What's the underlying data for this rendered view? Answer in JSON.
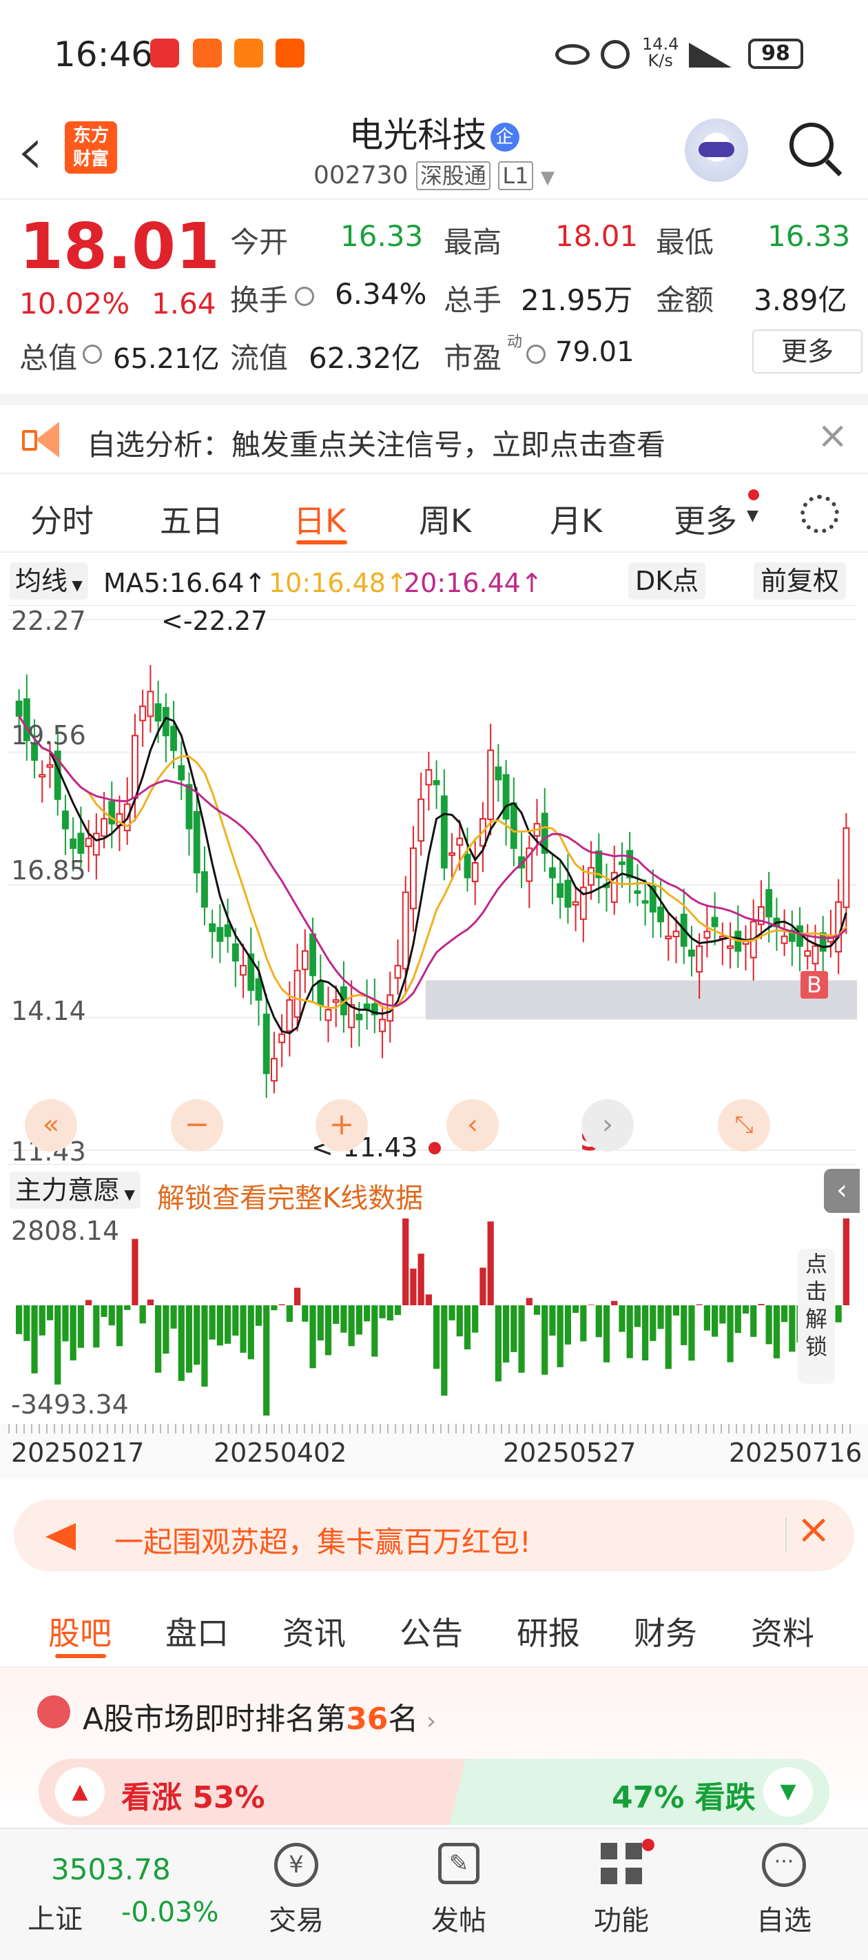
{
  "status_bar": {
    "time": "16:46",
    "net_speed_top": "14.4",
    "net_speed_bottom": "K/s",
    "battery": "98"
  },
  "header": {
    "back_label": "‹",
    "logo_line1": "东方",
    "logo_line2": "财富",
    "stock_name": "电光科技",
    "badge": "企",
    "stock_code": "002730",
    "market_tag": "深股通",
    "level_tag": "L1"
  },
  "quote": {
    "price": "18.01",
    "change_pct": "10.02%",
    "change_amt": "1.64",
    "rows": [
      [
        {
          "label": "今开",
          "value": "16.33",
          "color": "green"
        },
        {
          "label": "最高",
          "value": "18.01",
          "color": "red"
        },
        {
          "label": "最低",
          "value": "16.33",
          "color": "green"
        }
      ],
      [
        {
          "label": "换手",
          "value": "6.34%",
          "color": "dark"
        },
        {
          "label": "总手",
          "value": "21.95万",
          "color": "dark"
        },
        {
          "label": "金额",
          "value": "3.89亿",
          "color": "dark"
        }
      ]
    ],
    "total_mv_label": "总值",
    "total_mv": "65.21亿",
    "float_mv_label": "流值",
    "float_mv": "62.32亿",
    "pe_label": "市盈",
    "pe_sup": "动",
    "pe": "79.01",
    "more_button": "更多"
  },
  "banner": {
    "text": "自选分析：触发重点关注信号，立即点击查看"
  },
  "kline_tabs": [
    "分时",
    "五日",
    "日K",
    "周K",
    "月K",
    "更多"
  ],
  "kline_active": 2,
  "ma_bar": {
    "selector": "均线",
    "ma5": "MA5:16.64↑",
    "ma10": "10:16.48↑",
    "ma20": "20:16.44↑",
    "dk": "DK点",
    "adjust": "前复权"
  },
  "chart_data": {
    "type": "candlestick",
    "y_ticks": [
      "22.27",
      "19.56",
      "16.85",
      "14.14",
      "11.43"
    ],
    "ylim": [
      11.43,
      22.27
    ],
    "high_annotation": "<-22.27",
    "low_annotation": "<-11.43",
    "marker_b": "B",
    "marker_s": "S",
    "closes": [
      20.3,
      19.8,
      19.4,
      19.1,
      19.3,
      18.6,
      18.0,
      17.6,
      17.5,
      17.8,
      17.9,
      18.2,
      18.1,
      18.3,
      18.5,
      19.9,
      20.5,
      20.8,
      20.2,
      19.9,
      19.6,
      19.0,
      18.0,
      17.1,
      16.4,
      15.9,
      15.7,
      15.8,
      15.3,
      15.2,
      14.7,
      14.5,
      13.0,
      13.3,
      13.8,
      14.5,
      15.1,
      15.5,
      15.0,
      14.4,
      14.3,
      14.5,
      14.2,
      14.4,
      14.1,
      14.3,
      14.2,
      14.1,
      14.6,
      15.2,
      16.7,
      17.6,
      18.6,
      19.2,
      18.9,
      17.2,
      17.5,
      17.8,
      17.0,
      17.3,
      18.2,
      19.6,
      19.0,
      18.2,
      17.6,
      17.2,
      17.6,
      18.1,
      17.5,
      17.0,
      16.6,
      16.4,
      16.5,
      16.8,
      17.2,
      17.0,
      16.8,
      17.1,
      17.3,
      17.0,
      16.7,
      16.5,
      16.3,
      16.1,
      15.8,
      15.9,
      15.6,
      15.4,
      15.6,
      15.9,
      16.0,
      15.8,
      15.6,
      15.5,
      15.7,
      16.1,
      16.4,
      16.2,
      16.0,
      15.8,
      15.7,
      15.6,
      15.5,
      15.6,
      15.5,
      15.8,
      16.5,
      18.01
    ],
    "ma5": "MA5:16.64",
    "ma10": "10:16.48",
    "ma20": "20:16.44"
  },
  "sub_indicator": {
    "selector": "主力意愿",
    "unlock_text": "解锁查看完整K线数据",
    "y_top": "2808.14",
    "y_bottom": "-3493.34",
    "side_unlock": [
      "点",
      "击",
      "解",
      "锁"
    ]
  },
  "date_axis": [
    "20250217",
    "20250402",
    "20250527",
    "20250716"
  ],
  "promo": {
    "text": "一起围观苏超，集卡赢百万红包!"
  },
  "news_tabs": [
    "股吧",
    "盘口",
    "资讯",
    "公告",
    "研报",
    "财务",
    "资料"
  ],
  "news_active": 0,
  "rank": {
    "prefix": "A股市场即时排名第",
    "rank_num": "36",
    "suffix": "名",
    "bull_label": "看涨 53%",
    "bear_label": "47% 看跌",
    "bull_pct": 53
  },
  "bottom_nav": {
    "index_value": "3503.78",
    "index_name": "上证",
    "index_change": "-0.03%",
    "items": [
      "交易",
      "发帖",
      "功能",
      "自选"
    ]
  }
}
